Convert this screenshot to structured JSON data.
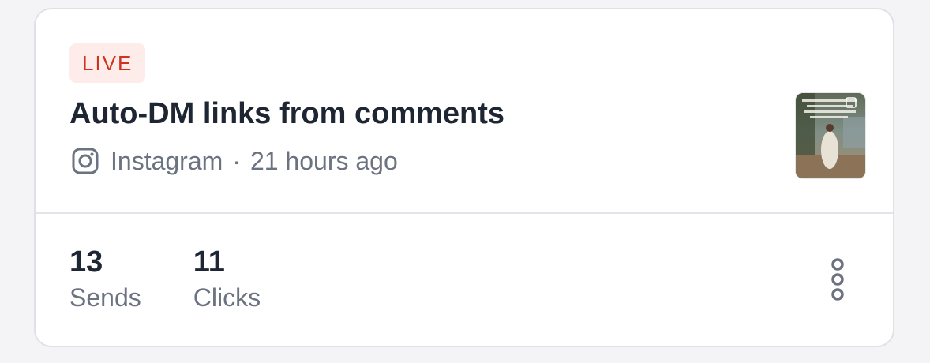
{
  "badge": {
    "text": "LIVE"
  },
  "title": "Auto-DM links from comments",
  "meta": {
    "platform": "Instagram",
    "separator": "·",
    "time": "21 hours ago",
    "icon": "instagram-icon"
  },
  "thumbnail": {
    "overlay_text": "How to style your fashion choose... your..."
  },
  "stats": [
    {
      "value": "13",
      "label": "Sends"
    },
    {
      "value": "11",
      "label": "Clicks"
    }
  ],
  "actions": {
    "more_icon": "vertical-dots-icon"
  },
  "colors": {
    "badge_bg": "#fdecea",
    "badge_text": "#d1321f",
    "title_text": "#1f2633",
    "muted_text": "#6b7280",
    "border": "#dfe1e6"
  }
}
